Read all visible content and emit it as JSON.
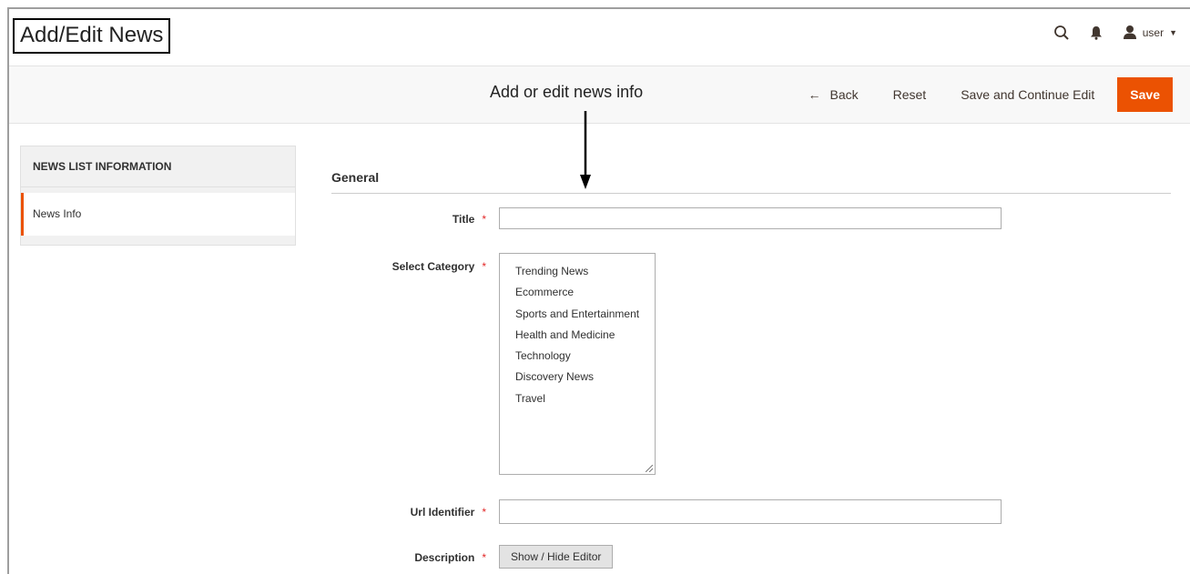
{
  "header": {
    "page_title": "Add/Edit News",
    "user_label": "user",
    "icons": [
      "search-icon",
      "bell-icon",
      "user-icon",
      "caret-down-icon"
    ]
  },
  "toolbar": {
    "annotation": "Add or edit news info",
    "back_label": "Back",
    "reset_label": "Reset",
    "save_continue_label": "Save and Continue Edit",
    "save_label": "Save"
  },
  "sidebar": {
    "title": "NEWS LIST INFORMATION",
    "items": [
      {
        "label": "News Info"
      }
    ]
  },
  "form": {
    "section_title": "General",
    "required_marker": "*",
    "fields": {
      "title": {
        "label": "Title",
        "value": ""
      },
      "category": {
        "label": "Select Category",
        "options": [
          "Trending News",
          "Ecommerce",
          "Sports and Entertainment",
          "Health and Medicine",
          "Technology",
          "Discovery News",
          "Travel"
        ]
      },
      "url_identifier": {
        "label": "Url Identifier",
        "value": ""
      },
      "description": {
        "label": "Description",
        "button_label": "Show / Hide Editor"
      }
    }
  },
  "colors": {
    "accent": "#eb5202",
    "required": "#e22626",
    "toolbar_bg": "#f8f8f8",
    "sidebar_bg": "#f1f1f1"
  }
}
